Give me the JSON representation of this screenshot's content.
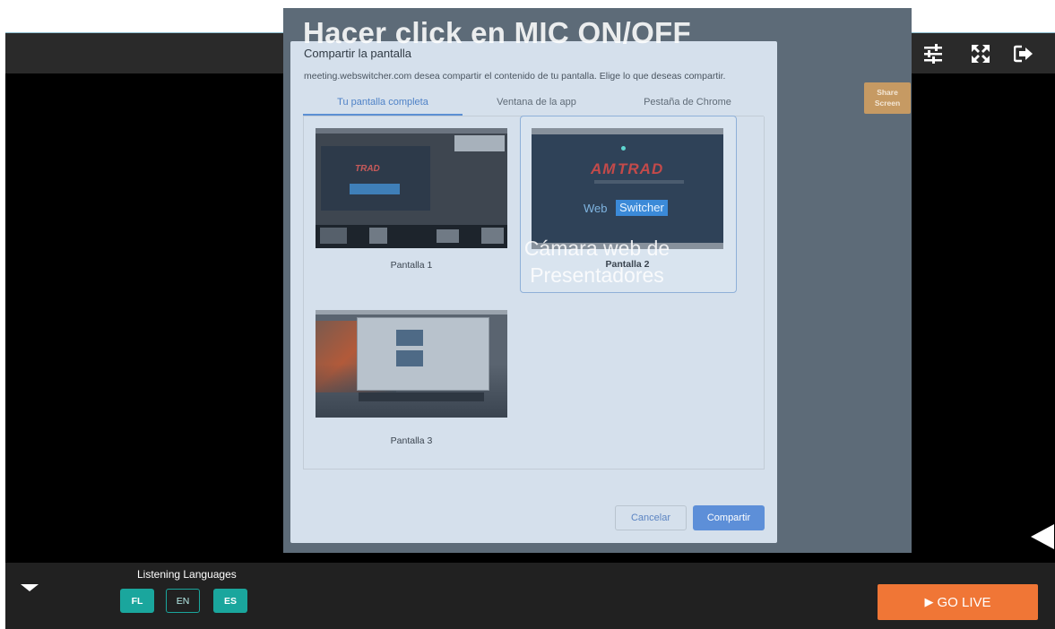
{
  "overlay": {
    "title": "Hacer click en MIC  ON/OFF",
    "webcam_label": "Cámara web de Presentadores"
  },
  "toolbar": {
    "icons": [
      "video-camera-icon",
      "chat-icon",
      "monitor-icon",
      "sliders-icon",
      "fullscreen-icon",
      "exit-icon"
    ],
    "tooltip": "Share Screen",
    "active_color": "#2fbf71"
  },
  "dialog": {
    "title": "Compartir la pantalla",
    "description": "meeting.webswitcher.com desea compartir el contenido de tu pantalla. Elige lo que deseas compartir.",
    "tabs": [
      {
        "label": "Tu pantalla completa",
        "active": true
      },
      {
        "label": "Ventana de la app",
        "active": false
      },
      {
        "label": "Pestaña de Chrome",
        "active": false
      }
    ],
    "screens": [
      {
        "label": "Pantalla 1",
        "selected": false
      },
      {
        "label": "Pantalla 2",
        "selected": true
      },
      {
        "label": "Pantalla 3",
        "selected": false
      }
    ],
    "thumb_brand": "TRAD",
    "thumb_brand_prefix": "AM",
    "thumb_web": "Web",
    "thumb_switcher": "Switcher",
    "cancel_label": "Cancelar",
    "share_label": "Compartir"
  },
  "bottom": {
    "languages_title": "Listening Languages",
    "languages": [
      {
        "code": "FL",
        "style": "filled"
      },
      {
        "code": "EN",
        "style": "outline"
      },
      {
        "code": "ES",
        "style": "filled"
      }
    ],
    "golive_label": "GO LIVE",
    "accent": "#f07636",
    "lang_color": "#1aa69d"
  }
}
